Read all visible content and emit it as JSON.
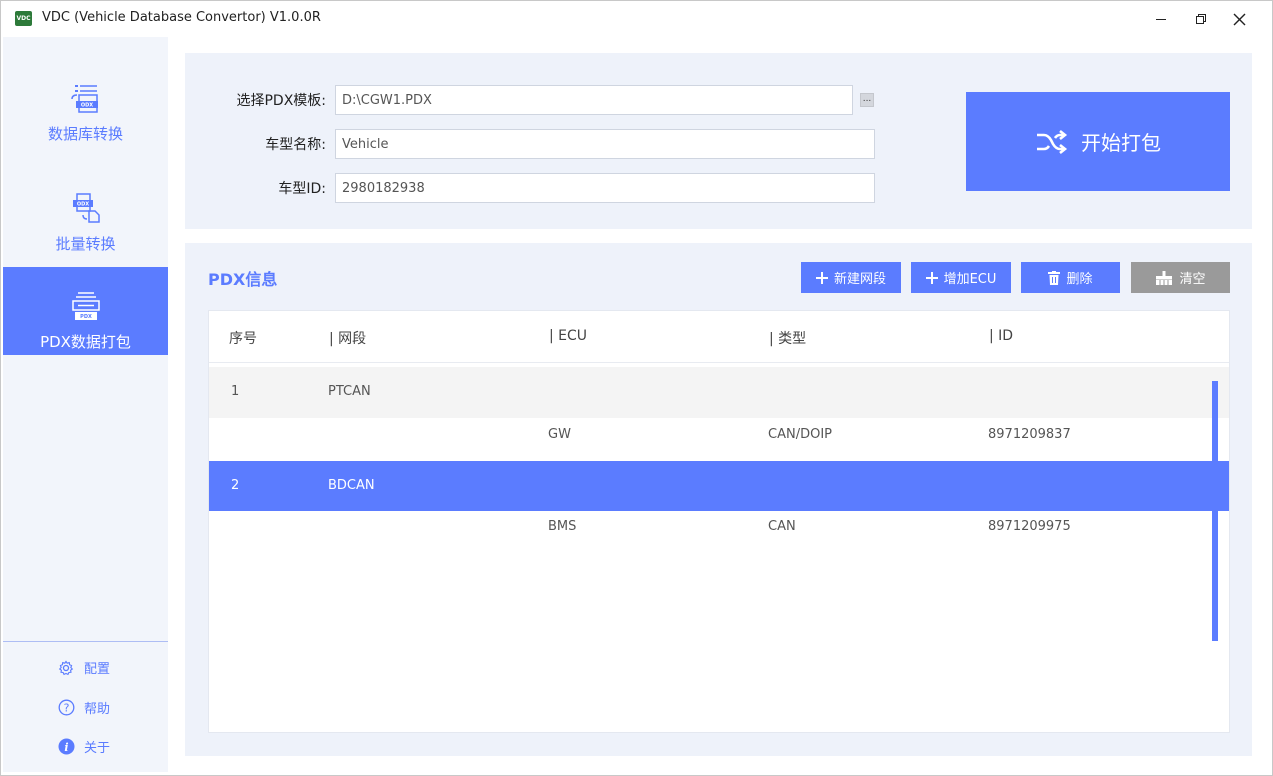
{
  "window": {
    "logo_text": "VDC",
    "title": "VDC (Vehicle Database Convertor) V1.0.0R"
  },
  "sidebar": {
    "items": [
      {
        "label": "数据库转换",
        "icon": "database-convert-icon"
      },
      {
        "label": "批量转换",
        "icon": "batch-convert-icon"
      },
      {
        "label": "PDX数据打包",
        "icon": "pdx-package-icon",
        "active": true
      }
    ],
    "icon_badges": [
      "ODX",
      "ODX",
      "PDX"
    ],
    "links": [
      {
        "label": "配置",
        "icon": "gear-icon"
      },
      {
        "label": "帮助",
        "icon": "help-icon"
      },
      {
        "label": "关于",
        "icon": "info-icon"
      }
    ]
  },
  "form": {
    "template_label": "选择PDX模板:",
    "template_value": "D:\\CGW1.PDX",
    "browse_label": "...",
    "model_name_label": "车型名称:",
    "model_name_value": "Vehicle",
    "model_id_label": "车型ID:",
    "model_id_value": "2980182938",
    "pack_button": "开始打包"
  },
  "pdx": {
    "title": "PDX信息",
    "buttons": {
      "new_segment": "新建网段",
      "add_ecu": "增加ECU",
      "delete": "删除",
      "clear": "清空"
    },
    "columns": [
      "序号",
      "| 网段",
      "| ECU",
      "| 类型",
      "| ID"
    ],
    "rows": [
      {
        "index": "1",
        "segment": "PTCAN",
        "ecus": [
          {
            "ecu": "GW",
            "type": "CAN/DOIP",
            "id": "8971209837"
          }
        ]
      },
      {
        "index": "2",
        "segment": "BDCAN",
        "selected": true,
        "ecus": [
          {
            "ecu": "BMS",
            "type": "CAN",
            "id": "8971209975"
          }
        ]
      }
    ]
  },
  "colors": {
    "accent": "#5b7cff",
    "panel_bg": "#eef2fa",
    "clear_button": "#9a9a9a"
  }
}
